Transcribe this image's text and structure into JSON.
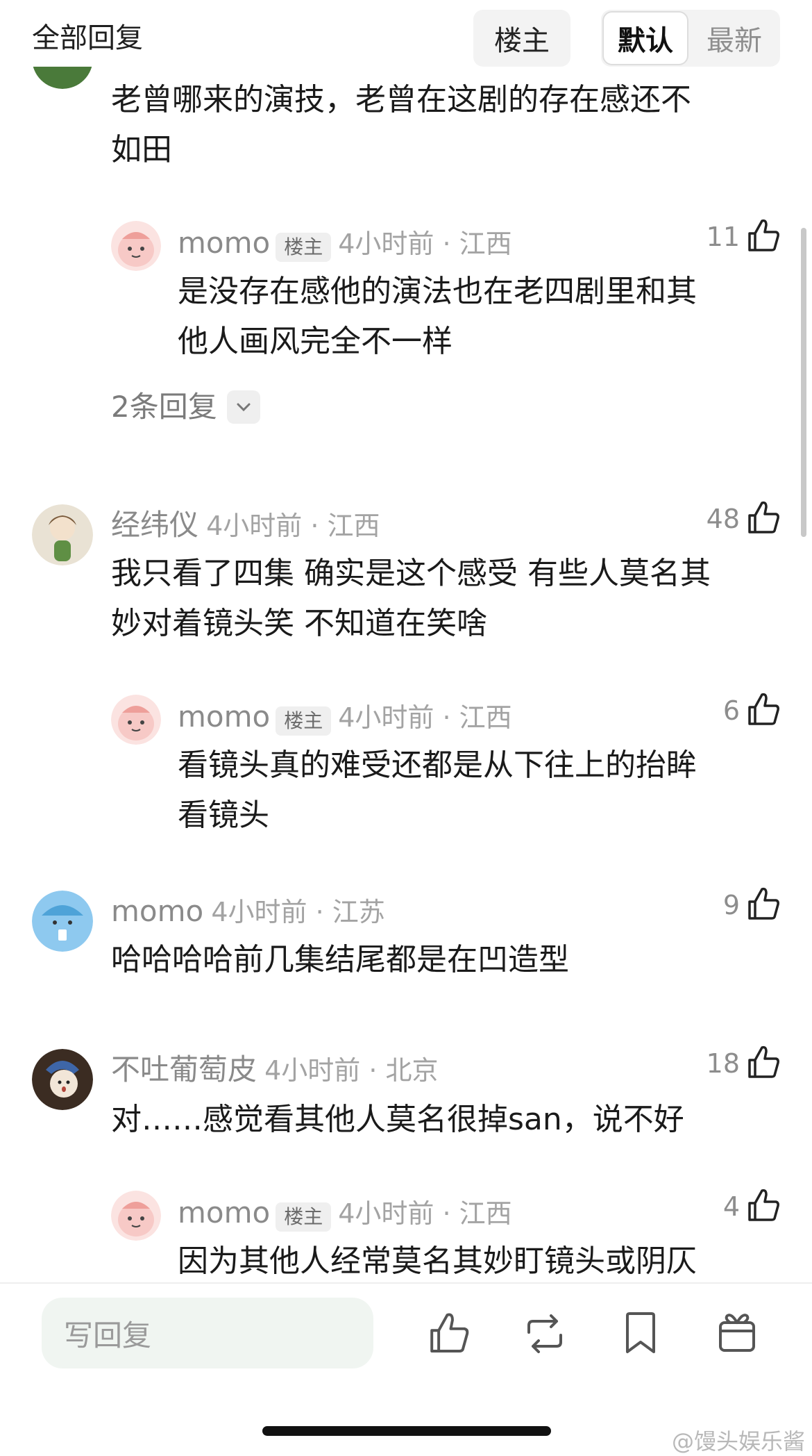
{
  "header": {
    "title": "全部回复",
    "sort_op": "楼主",
    "sort_default": "默认",
    "sort_latest": "最新"
  },
  "comments": [
    {
      "text_lines": [
        "老曾哪来的演技，老曾在这剧的存在感还不",
        "如田"
      ]
    },
    {
      "name": "momo",
      "badge": "楼主",
      "meta": "4小时前 · 江西",
      "likes": "11",
      "text_lines": [
        "是没存在感他的演法也在老四剧里和其",
        "他人画风完全不一样"
      ],
      "more_replies": "2条回复"
    },
    {
      "name": "经纬仪",
      "meta": "4小时前 · 江西",
      "likes": "48",
      "text_lines": [
        "我只看了四集 确实是这个感受 有些人莫名其",
        "妙对着镜头笑 不知道在笑啥"
      ]
    },
    {
      "name": "momo",
      "badge": "楼主",
      "meta": "4小时前 · 江西",
      "likes": "6",
      "text_lines": [
        "看镜头真的难受还都是从下往上的抬眸",
        "看镜头"
      ]
    },
    {
      "name": "momo",
      "meta": "4小时前 · 江苏",
      "likes": "9",
      "text_lines": [
        "哈哈哈哈前几集结尾都是在凹造型"
      ]
    },
    {
      "name": "不吐葡萄皮",
      "meta": "4小时前 · 北京",
      "likes": "18",
      "text_lines": [
        "对……感觉看其他人莫名很掉san，说不好"
      ]
    },
    {
      "name": "momo",
      "badge": "楼主",
      "meta": "4小时前 · 江西",
      "likes": "4",
      "text_lines": [
        "因为其他人经常莫名其妙盯镜头或阴仄"
      ]
    }
  ],
  "bottom_bar": {
    "reply_placeholder": "写回复"
  },
  "watermark": "@馒头娱乐酱",
  "icons": [
    "thumb-up-icon",
    "repost-icon",
    "bookmark-icon",
    "gift-icon",
    "chevron-down-icon"
  ],
  "colors": {
    "text": "#1a1a1a",
    "secondary": "#8a8a8a",
    "input_bg": "#f0f5f1",
    "avatar_pink": "#f7c9c6",
    "avatar_blue": "#8ec9ef"
  }
}
